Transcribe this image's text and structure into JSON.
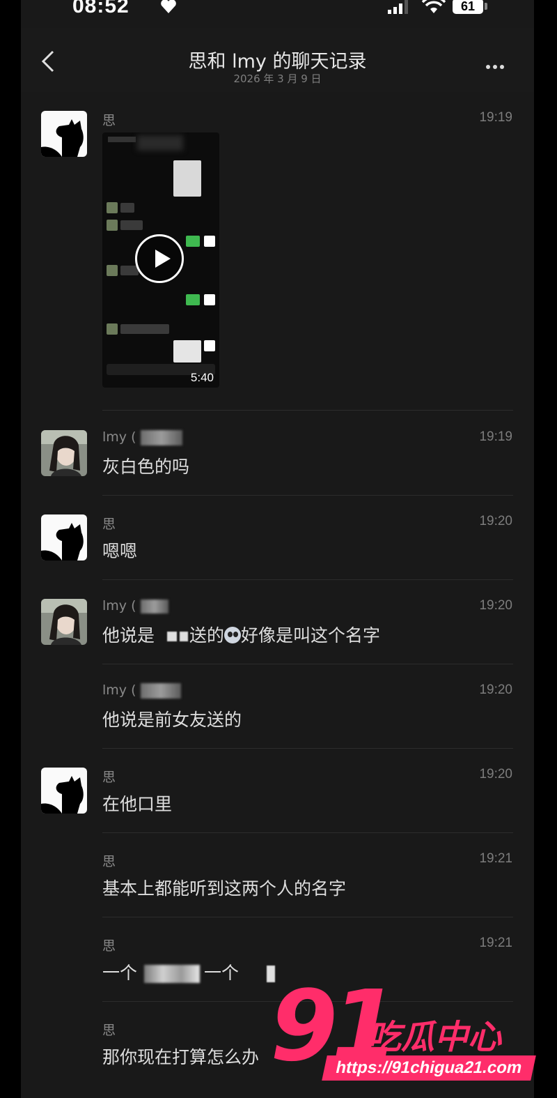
{
  "status_bar": {
    "time": "08:52",
    "battery": "61"
  },
  "header": {
    "title": "思和 lmy 的聊天记录",
    "subtitle": "2026 年 3 月 9 日"
  },
  "messages": [
    {
      "sender": "思",
      "time": "19:19",
      "video_duration": "5:40"
    },
    {
      "sender": "lmy (",
      "time": "19:19",
      "text": "灰白色的吗"
    },
    {
      "sender": "思",
      "time": "19:20",
      "text": "嗯嗯"
    },
    {
      "sender": "lmy (",
      "time": "19:20",
      "text_a": "他说是",
      "text_b": "送的",
      "text_c": "好像是叫这个名字"
    },
    {
      "sender": "lmy (",
      "time": "19:20",
      "text": "他说是前女友送的"
    },
    {
      "sender": "思",
      "time": "19:20",
      "text": "在他口里"
    },
    {
      "sender": "思",
      "time": "19:21",
      "text": "基本上都能听到这两个人的名字"
    },
    {
      "sender": "思",
      "time": "19:21",
      "text_a": "一个",
      "text_b": "一个"
    },
    {
      "sender": "思",
      "time": "",
      "text": "那你现在打算怎么办"
    }
  ],
  "watermark": {
    "brand_num": "91",
    "brand_cn": "吃瓜中心",
    "url": "https://91chigua21.com"
  }
}
